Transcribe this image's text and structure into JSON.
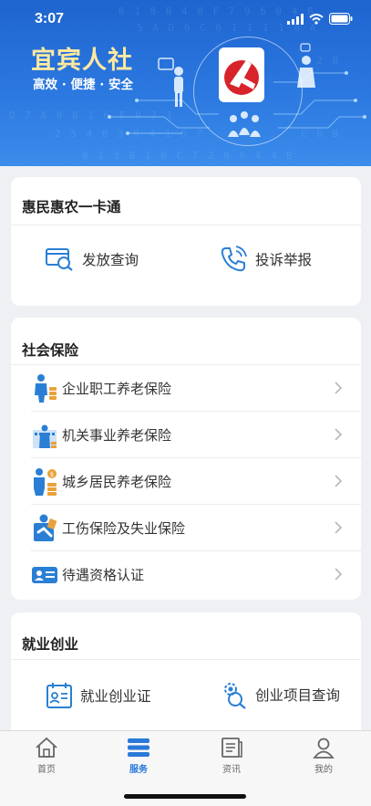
{
  "status": {
    "time": "3:07"
  },
  "banner": {
    "title": "宜宾人社",
    "slogan": "高效 · 便捷 · 安全"
  },
  "card1": {
    "title": "惠民惠农一卡通",
    "actions": [
      {
        "label": "发放查询",
        "icon": "card-search-icon"
      },
      {
        "label": "投诉举报",
        "icon": "phone-icon"
      }
    ]
  },
  "card2": {
    "title": "社会保险",
    "items": [
      {
        "label": "企业职工养老保险",
        "icon": "worker-pension-icon"
      },
      {
        "label": "机关事业养老保险",
        "icon": "institution-pension-icon"
      },
      {
        "label": "城乡居民养老保险",
        "icon": "resident-pension-icon"
      },
      {
        "label": "工伤保险及失业保险",
        "icon": "injury-insurance-icon"
      },
      {
        "label": "待遇资格认证",
        "icon": "id-card-icon"
      }
    ]
  },
  "card3": {
    "title": "就业创业",
    "actions": [
      {
        "label": "就业创业证",
        "icon": "employment-cert-icon"
      },
      {
        "label": "创业项目查询",
        "icon": "project-search-icon"
      }
    ]
  },
  "tabs": [
    {
      "label": "首页",
      "icon": "home-icon"
    },
    {
      "label": "服务",
      "icon": "service-icon",
      "active": true
    },
    {
      "label": "资讯",
      "icon": "news-icon"
    },
    {
      "label": "我的",
      "icon": "user-icon"
    }
  ],
  "colors": {
    "accent": "#2a78d8",
    "banner": "#2b78e0",
    "icon_blue": "#2a7fd4"
  }
}
